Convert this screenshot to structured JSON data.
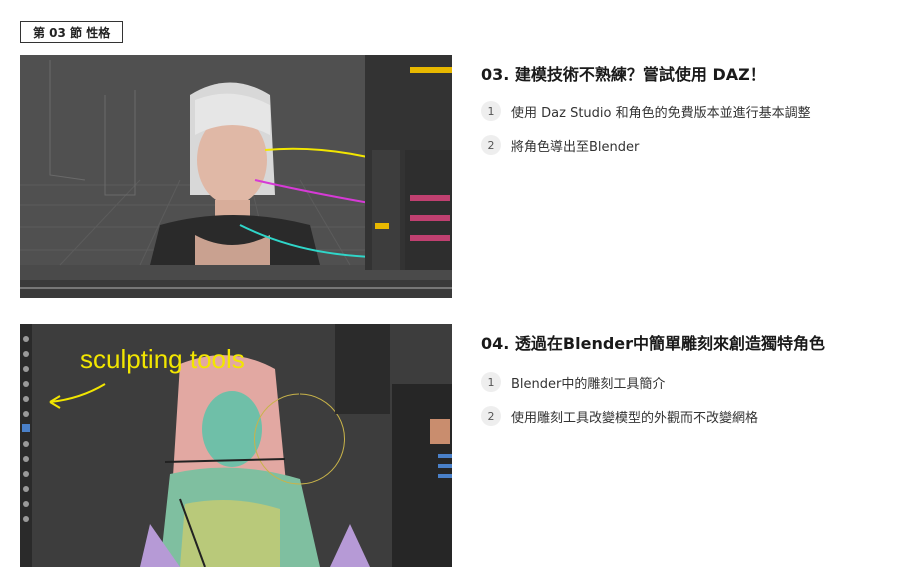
{
  "section": {
    "label": "第 03 節 性格"
  },
  "lessons": [
    {
      "title": "03. 建模技術不熟練？嘗試使用 DAZ！",
      "items": [
        {
          "num": "1",
          "text": "使用 Daz Studio 和角色的免費版本並進行基本調整"
        },
        {
          "num": "2",
          "text": "將角色導出至Blender"
        }
      ]
    },
    {
      "title": "04. 透過在Blender中簡單雕刻來創造獨特角色",
      "items": [
        {
          "num": "1",
          "text": "Blender中的雕刻工具簡介"
        },
        {
          "num": "2",
          "text": "使用雕刻工具改變模型的外觀而不改變網格"
        }
      ],
      "overlay_text": "sculpting tools"
    }
  ],
  "colors": {
    "annotation_yellow": "#f2e600",
    "annotation_magenta": "#d63ad6",
    "annotation_cyan": "#2fd6c9"
  }
}
